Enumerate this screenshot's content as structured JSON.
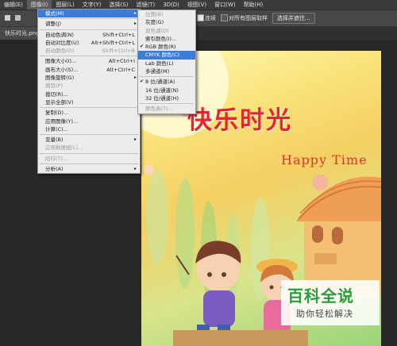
{
  "menubar": {
    "items": [
      "编辑(E)",
      "图像(I)",
      "图层(L)",
      "文字(Y)",
      "选择(S)",
      "滤镜(T)",
      "3D(D)",
      "视图(V)",
      "窗口(W)",
      "帮助(H)"
    ],
    "active_index": 1
  },
  "options_bar": {
    "checkbox1_label": "连续",
    "checkbox2_label": "对所有图层取样",
    "button_label": "选择并遮住..."
  },
  "document_tab": {
    "title": "快乐时光.png @ 1"
  },
  "image_menu": {
    "items": [
      {
        "label": "模式(M)",
        "shortcut": "",
        "submenu": true,
        "highlight": true,
        "disabled": false
      },
      {
        "sep": true
      },
      {
        "label": "调整(J)",
        "shortcut": "",
        "submenu": true,
        "disabled": false
      },
      {
        "sep": true
      },
      {
        "label": "自动色调(N)",
        "shortcut": "Shift+Ctrl+L",
        "disabled": false
      },
      {
        "label": "自动对比度(U)",
        "shortcut": "Alt+Shift+Ctrl+L",
        "disabled": false
      },
      {
        "label": "自动颜色(O)",
        "shortcut": "Shift+Ctrl+B",
        "disabled": true
      },
      {
        "sep": true
      },
      {
        "label": "图像大小(I)...",
        "shortcut": "Alt+Ctrl+I",
        "disabled": false
      },
      {
        "label": "画布大小(S)...",
        "shortcut": "Alt+Ctrl+C",
        "disabled": false
      },
      {
        "label": "图像旋转(G)",
        "shortcut": "",
        "submenu": true,
        "disabled": false
      },
      {
        "label": "裁剪(P)",
        "shortcut": "",
        "disabled": true
      },
      {
        "label": "裁切(R)...",
        "shortcut": "",
        "disabled": false
      },
      {
        "label": "显示全部(V)",
        "shortcut": "",
        "disabled": false
      },
      {
        "sep": true
      },
      {
        "label": "复制(D)...",
        "shortcut": "",
        "disabled": false
      },
      {
        "label": "应用图像(Y)...",
        "shortcut": "",
        "disabled": false
      },
      {
        "label": "计算(C)...",
        "shortcut": "",
        "disabled": false
      },
      {
        "sep": true
      },
      {
        "label": "变量(B)",
        "shortcut": "",
        "submenu": true,
        "disabled": false
      },
      {
        "label": "应用数据组(L)...",
        "shortcut": "",
        "disabled": true
      },
      {
        "sep": true
      },
      {
        "label": "陷印(T)...",
        "shortcut": "",
        "disabled": true
      },
      {
        "sep": true
      },
      {
        "label": "分析(A)",
        "shortcut": "",
        "submenu": true,
        "disabled": false
      }
    ]
  },
  "mode_menu": {
    "items": [
      {
        "label": "位图(B)",
        "disabled": true
      },
      {
        "label": "灰度(G)",
        "disabled": false
      },
      {
        "label": "双色调(D)",
        "disabled": true
      },
      {
        "label": "索引颜色(I)...",
        "disabled": false
      },
      {
        "label": "RGB 颜色(R)",
        "checked": true,
        "disabled": false
      },
      {
        "label": "CMYK 颜色(C)",
        "highlight": true,
        "disabled": false
      },
      {
        "label": "Lab 颜色(L)",
        "disabled": false
      },
      {
        "label": "多通道(M)",
        "disabled": false
      },
      {
        "sep": true
      },
      {
        "label": "8 位/通道(A)",
        "checked": true,
        "disabled": false
      },
      {
        "label": "16 位/通道(N)",
        "disabled": false
      },
      {
        "label": "32 位/通道(H)",
        "disabled": false
      },
      {
        "sep": true
      },
      {
        "label": "颜色表(T)...",
        "disabled": true
      }
    ]
  },
  "artwork": {
    "title": "快乐时光",
    "subtitle": "Happy Time"
  },
  "watermark": {
    "title": "百科全说",
    "subtitle": "助你轻松解决"
  },
  "colors": {
    "menu_highlight": "#3d7bd8",
    "title_red": "#e8252a",
    "subtitle_red": "#d8382f",
    "watermark_green": "#2c9a3d"
  }
}
